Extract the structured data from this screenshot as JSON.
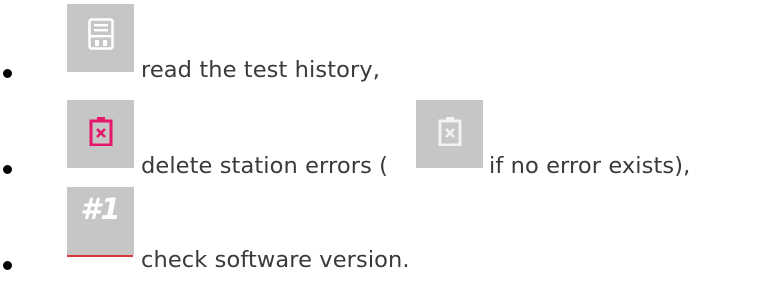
{
  "items": [
    {
      "icon": "save-icon",
      "text": "read the test history,"
    },
    {
      "icon": "battery-error-icon",
      "icon_color": "#e5176b",
      "text_before": "delete station errors (",
      "secondary_icon": "battery-error-gray-icon",
      "secondary_icon_color": "#f2f2f2",
      "text_after": "if no error exists),"
    },
    {
      "icon": "version-hash-icon",
      "icon_text": "#1",
      "text": "check software version."
    }
  ],
  "colors": {
    "tile": "#c6c6c6",
    "accent": "#e5176b",
    "underline": "#d53b3b"
  }
}
